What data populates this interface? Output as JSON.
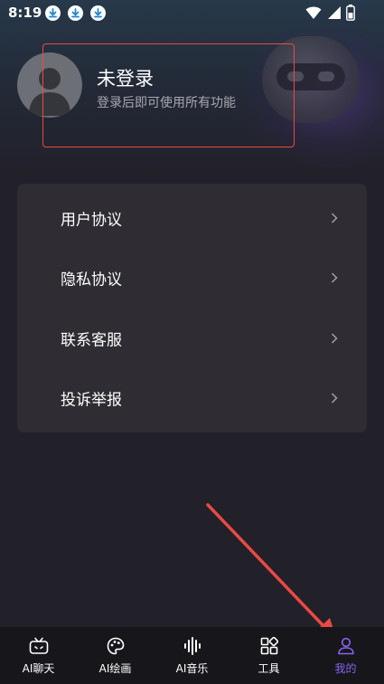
{
  "status_bar": {
    "time": "8:19"
  },
  "profile": {
    "title": "未登录",
    "subtitle": "登录后即可使用所有功能"
  },
  "menu": {
    "items": [
      {
        "label": "用户协议"
      },
      {
        "label": "隐私协议"
      },
      {
        "label": "联系客服"
      },
      {
        "label": "投诉举报"
      }
    ]
  },
  "bottom_nav": {
    "items": [
      {
        "label": "AI聊天",
        "icon": "tv-icon"
      },
      {
        "label": "AI绘画",
        "icon": "palette-icon"
      },
      {
        "label": "AI音乐",
        "icon": "soundwave-icon"
      },
      {
        "label": "工具",
        "icon": "grid-icon"
      },
      {
        "label": "我的",
        "icon": "person-icon"
      }
    ],
    "active_index": 4
  },
  "colors": {
    "accent": "#8a63f2",
    "annotation": "#e84a43",
    "background": "#222029",
    "card": "#2f2d33"
  }
}
